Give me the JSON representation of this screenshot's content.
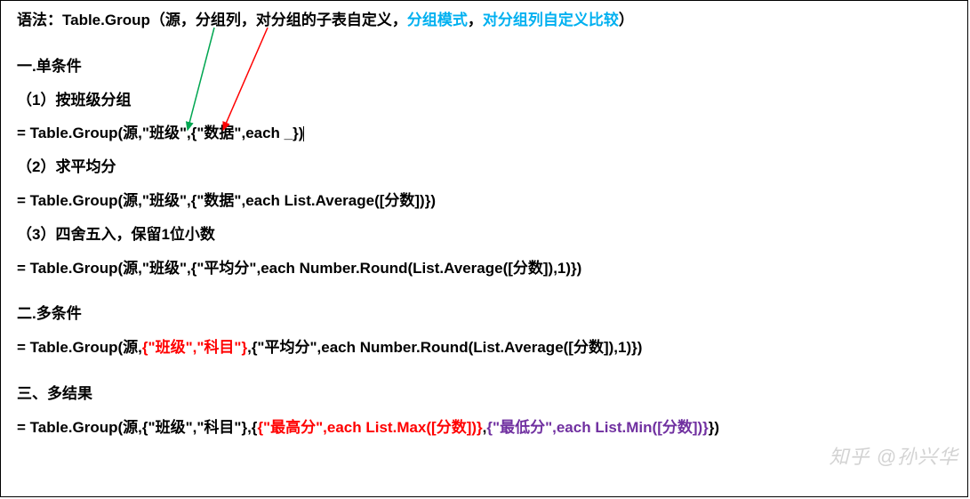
{
  "syntax": {
    "prefix": "语法：Table.Group（源，",
    "arg2": "分组列",
    "arg3_sep": "，",
    "arg3": "对分组的子表自定义",
    "arg4_sep": "，",
    "arg4": "分组模式",
    "arg5_sep": "，",
    "arg5": "对分组列自定义比较",
    "suffix": "）"
  },
  "sec1_title": "一.单条件",
  "sec1_1_label": "（1）按班级分组",
  "sec1_1_code": "= Table.Group(源,\"班级\",{\"数据\",each _})",
  "sec1_2_label": "（2）求平均分",
  "sec1_2_code": "= Table.Group(源,\"班级\",{\"数据\",each List.Average([分数])})",
  "sec1_3_label": "（3）四舍五入，保留1位小数",
  "sec1_3_code": "= Table.Group(源,\"班级\",{\"平均分\",each Number.Round(List.Average([分数]),1)})",
  "sec2_title": "二.多条件",
  "sec2_code_a": "= Table.Group(源,",
  "sec2_code_b": "{\"班级\",\"科目\"}",
  "sec2_code_c": ",{\"平均分\",each Number.Round(List.Average([分数]),1)})",
  "sec3_title": "三、多结果",
  "sec3_code_a": "= Table.Group(源,{\"班级\",\"科目\"},{",
  "sec3_code_b": "{\"最高分\",each List.Max([分数])}",
  "sec3_code_c": ",",
  "sec3_code_d": "{\"最低分\",each List.Min([分数])}",
  "sec3_code_e": "})",
  "watermark": "知乎 @孙兴华"
}
